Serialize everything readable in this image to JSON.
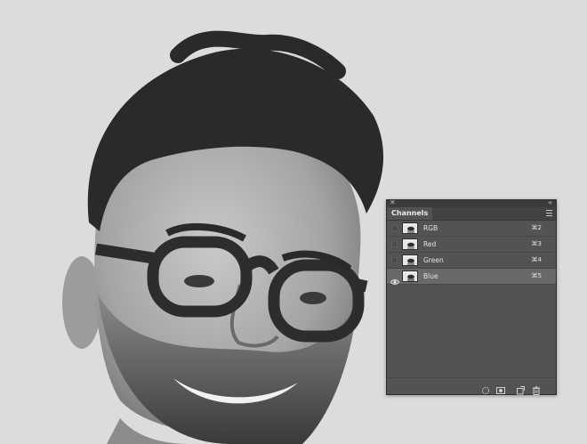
{
  "canvas": {
    "subject": "portrait-photo"
  },
  "panel": {
    "title": "Channels",
    "channels": [
      {
        "name": "RGB",
        "shortcut": "⌘2",
        "visible": false,
        "selected": false
      },
      {
        "name": "Red",
        "shortcut": "⌘3",
        "visible": false,
        "selected": false
      },
      {
        "name": "Green",
        "shortcut": "⌘4",
        "visible": false,
        "selected": false
      },
      {
        "name": "Blue",
        "shortcut": "⌘5",
        "visible": true,
        "selected": true
      }
    ],
    "footer_icons": [
      "load-selection-icon",
      "save-selection-icon",
      "new-channel-icon",
      "delete-channel-icon"
    ]
  },
  "colors": {
    "panel_bg": "#535353",
    "selected_row": "#696969",
    "canvas_bg": "#dcdcdc"
  }
}
